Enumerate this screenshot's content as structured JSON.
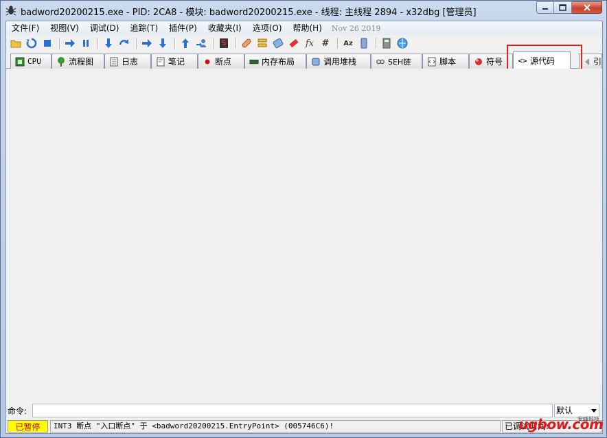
{
  "window": {
    "title": "badword20200215.exe - PID: 2CA8 - 模块: badword20200215.exe - 线程: 主线程 2894 - x32dbg [管理员]"
  },
  "menu": {
    "items": [
      "文件(F)",
      "视图(V)",
      "调试(D)",
      "追踪(T)",
      "插件(P)",
      "收藏夹(I)",
      "选项(O)",
      "帮助(H)"
    ],
    "date": "Nov 26 2019"
  },
  "toolbar": {
    "icons": [
      "open-icon",
      "restart-icon",
      "stop-icon",
      "run-icon",
      "pause-icon",
      "step-into-icon",
      "step-over-icon",
      "trace-into-icon",
      "trace-over-icon",
      "execute-till-return-icon",
      "run-to-user-code-icon",
      "scylla-icon",
      "patch-icon",
      "comment-icon",
      "label-icon",
      "bookmark-icon",
      "function-icon",
      "hash-icon",
      "strings-icon",
      "calculator-icon",
      "help-icon"
    ]
  },
  "tabs": [
    {
      "label": "CPU",
      "icon": "cpu-icon"
    },
    {
      "label": "流程图",
      "icon": "graph-icon"
    },
    {
      "label": "日志",
      "icon": "log-icon"
    },
    {
      "label": "笔记",
      "icon": "notes-icon"
    },
    {
      "label": "断点",
      "icon": "breakpoint-icon"
    },
    {
      "label": "内存布局",
      "icon": "memory-icon"
    },
    {
      "label": "调用堆栈",
      "icon": "callstack-icon"
    },
    {
      "label": "SEH链",
      "icon": "seh-icon"
    },
    {
      "label": "脚本",
      "icon": "script-icon"
    },
    {
      "label": "符号",
      "icon": "symbol-icon"
    },
    {
      "label": "源代码",
      "icon": "source-icon"
    },
    {
      "label": "引",
      "icon": "references-icon"
    }
  ],
  "command": {
    "label": "命令:",
    "value": "",
    "mode": "默认"
  },
  "status": {
    "state": "已暂停",
    "message": "INT3 断点 \"入口断点\" 于 <badword20200215.EntryPoint> (005746C6)!",
    "right": "已调试时间:"
  },
  "watermark": {
    "text": "ugbow.com",
    "small": "安峰科技"
  },
  "colors": {
    "highlight_box": "#e02020",
    "paused_bg": "#ffff00",
    "paused_fg": "#c00000"
  }
}
